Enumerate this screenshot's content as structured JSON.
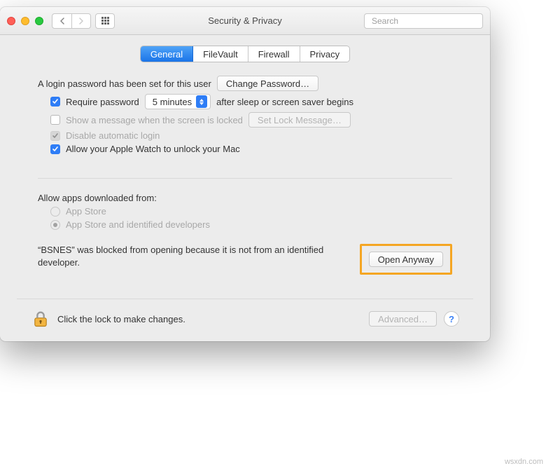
{
  "window": {
    "title": "Security & Privacy",
    "search_placeholder": "Search"
  },
  "tabs": [
    "General",
    "FileVault",
    "Firewall",
    "Privacy"
  ],
  "login": {
    "text": "A login password has been set for this user",
    "change_btn": "Change Password…",
    "require_label": "Require password",
    "delay": "5 minutes",
    "after_sleep": "after sleep or screen saver begins",
    "show_message": "Show a message when the screen is locked",
    "set_lock_btn": "Set Lock Message…",
    "disable_auto": "Disable automatic login",
    "apple_watch": "Allow your Apple Watch to unlock your Mac"
  },
  "allow": {
    "title": "Allow apps downloaded from:",
    "opt1": "App Store",
    "opt2": "App Store and identified developers",
    "blocked_msg": "“BSNES” was blocked from opening because it is not from an identified developer.",
    "open_btn": "Open Anyway"
  },
  "footer": {
    "lock_text": "Click the lock to make changes.",
    "advanced_btn": "Advanced…"
  },
  "watermark": "wsxdn.com"
}
